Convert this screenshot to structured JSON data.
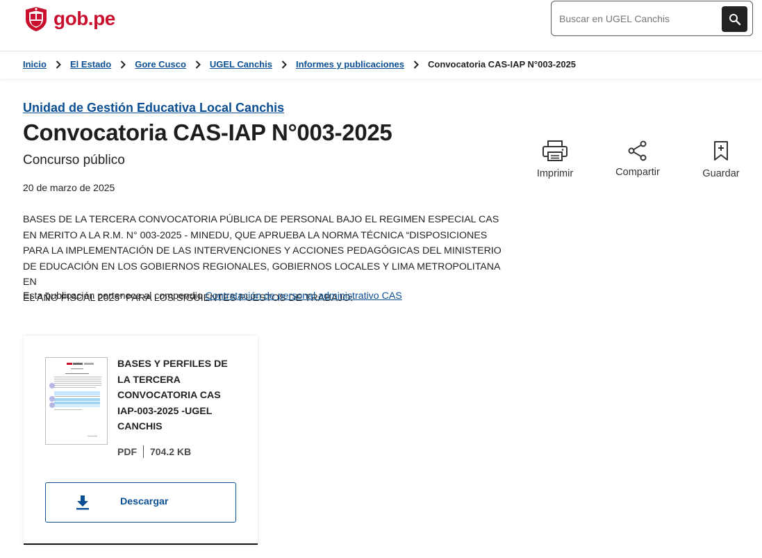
{
  "header": {
    "logo_text": "gob.pe",
    "search_placeholder": "Buscar en UGEL Canchis",
    "brand_color": "#c8102e"
  },
  "breadcrumb": {
    "items": [
      "Inicio",
      "El Estado",
      "Gore Cusco",
      "UGEL Canchis",
      "Informes y publicaciones"
    ],
    "current": "Convocatoria CAS-IAP N°003-2025"
  },
  "main": {
    "org_link": "Unidad de Gestión Educativa Local Canchis",
    "title": "Convocatoria CAS-IAP N°003-2025",
    "subtitle": "Concurso público",
    "date": "20 de marzo de 2025",
    "description_lines": [
      "BASES DE LA TERCERA CONVOCATORIA PÚBLICA DE PERSONAL BAJO EL REGIMEN ESPECIAL CAS",
      "EN MERITO A LA R.M. N° 003-2025 - MINEDU, QUE APRUEBA LA NORMA TÉCNICA “DISPOSICIONES",
      "PARA LA IMPLEMENTACIÓN DE LAS INTERVENCIONES Y ACCIONES PEDAGÓGICAS DEL MINISTERIO",
      "DE EDUCACIÓN EN LOS GOBIERNOS REGIONALES, GOBIERNOS LOCALES Y LIMA METROPOLITANA EN",
      "EL AÑO FISCAL 2025” PARA LOS SIGUIENTES PUESTOS DE TRABAJO:"
    ],
    "compendium_prefix": "Esta publicación pertenece al compendio",
    "compendium_link": "Contratación de personal administrativo CAS",
    "link_color": "#0b4f93"
  },
  "actions": {
    "print": {
      "label": "Imprimir",
      "icon": "printer-icon"
    },
    "share": {
      "label": "Compartir",
      "icon": "share-icon"
    },
    "save": {
      "label": "Guardar",
      "icon": "bookmark-icon"
    }
  },
  "document": {
    "title_lines": [
      "BASES Y PERFILES DE",
      "LA TERCERA",
      "CONVOCATORIA CAS",
      "IAP-003-2025 -UGEL",
      "CANCHIS"
    ],
    "format": "PDF",
    "size": "704.2 KB",
    "download_label": "Descargar"
  }
}
